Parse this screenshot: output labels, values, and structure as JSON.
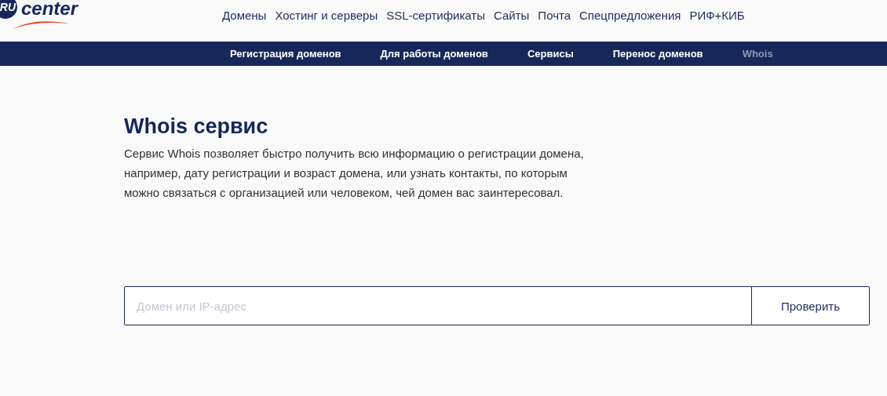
{
  "logo": {
    "badge": "RU",
    "word": "center"
  },
  "main_nav": [
    {
      "label": "Домены"
    },
    {
      "label": "Хостинг и серверы"
    },
    {
      "label": "SSL-сертификаты"
    },
    {
      "label": "Сайты"
    },
    {
      "label": "Почта"
    },
    {
      "label": "Спецпредложения"
    },
    {
      "label": "РИФ+КИБ"
    }
  ],
  "sub_nav": [
    {
      "label": "Регистрация доменов",
      "selected": false
    },
    {
      "label": "Для работы доменов",
      "selected": false
    },
    {
      "label": "Сервисы",
      "selected": false
    },
    {
      "label": "Перенос доменов",
      "selected": false
    },
    {
      "label": "Whois",
      "selected": true
    }
  ],
  "heading": "Whois сервис",
  "description": "Сервис Whois позволяет быстро получить всю информацию о регистрации домена, например, дату регистрации и возраст домена, или узнать контакты, по которым можно связаться с организацией или человеком, чей домен вас заинтересовал.",
  "search": {
    "placeholder": "Домен или IP-адрес",
    "button": "Проверить"
  }
}
